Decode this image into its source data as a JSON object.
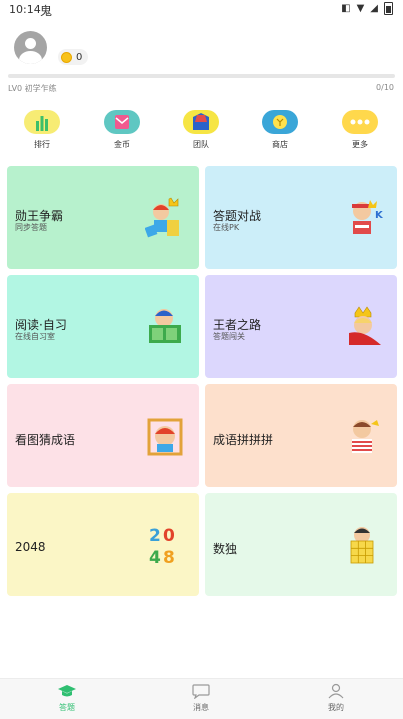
{
  "status_bar": {
    "time": "10:14",
    "ghost_glyph": "鬼"
  },
  "profile": {
    "coins": "0"
  },
  "level": {
    "label": "LV0 初学乍练",
    "progress_text": "0/10",
    "progress_fraction": 0
  },
  "quick_actions": [
    {
      "label": "排行",
      "icon": "ranking-icon",
      "color": "#f7ec74"
    },
    {
      "label": "金币",
      "icon": "coin-mail-icon",
      "color": "#5fc7c2"
    },
    {
      "label": "团队",
      "icon": "team-flag-icon",
      "color": "#f6e544"
    },
    {
      "label": "商店",
      "icon": "store-icon",
      "color": "#3aa6d8"
    },
    {
      "label": "更多",
      "icon": "more-icon",
      "color": "#ffd84c"
    }
  ],
  "cards": [
    {
      "title": "勋王争霸",
      "sub": "同步答题",
      "bg": "#b7f1cd",
      "art": "king-boy-icon"
    },
    {
      "title": "答题对战",
      "sub": "在线PK",
      "bg": "#cceef9",
      "art": "fighter-boy-icon"
    },
    {
      "title": "阅读·自习",
      "sub": "在线自习室",
      "bg": "#b2f6e3",
      "art": "reading-boy-icon"
    },
    {
      "title": "王者之路",
      "sub": "答题闯关",
      "bg": "#dcd7fd",
      "art": "crown-king-icon"
    },
    {
      "title": "看图猜成语",
      "sub": "",
      "bg": "#fde1e7",
      "art": "picture-frame-boy-icon"
    },
    {
      "title": "成语拼拼拼",
      "sub": "",
      "bg": "#fde0cc",
      "art": "striped-boy-icon"
    },
    {
      "title": "2048",
      "sub": "",
      "bg": "#fbf6c6",
      "art": "number-2048-icon"
    },
    {
      "title": "数独",
      "sub": "",
      "bg": "#e5f9e9",
      "art": "sudoku-grid-boy-icon"
    }
  ],
  "bottom_nav": [
    {
      "label": "答题",
      "icon": "graduation-cap-icon",
      "active": true
    },
    {
      "label": "消息",
      "icon": "chat-bubble-icon",
      "active": false
    },
    {
      "label": "我的",
      "icon": "person-icon",
      "active": false
    }
  ],
  "colors": {
    "accent": "#2fbf71",
    "progress_track": "#e6e6e6"
  }
}
